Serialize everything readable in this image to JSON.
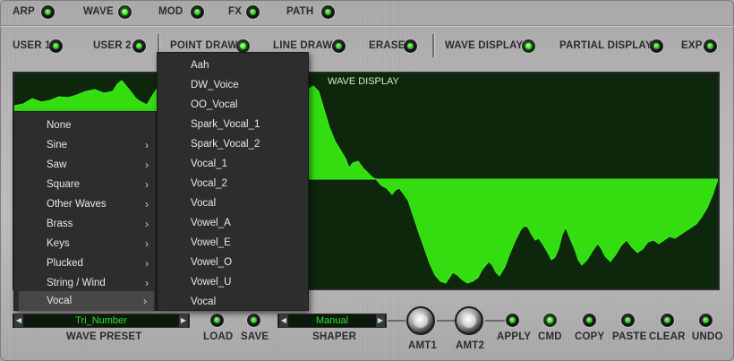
{
  "top_tabs": [
    "ARP",
    "WAVE",
    "MOD",
    "FX",
    "PATH"
  ],
  "toolbar": {
    "user1": "USER 1",
    "user2": "USER 2",
    "point_draw": "POINT DRAW",
    "line_draw": "LINE DRAW",
    "erase": "ERASE",
    "wave_display": "WAVE DISPLAY",
    "partial_display": "PARTIAL DISPLAY",
    "exp": "EXP"
  },
  "display": {
    "title": "WAVE DISPLAY",
    "wave_color": "#33dd10",
    "background": "#0d260c"
  },
  "menu_categories": [
    "None",
    "Sine",
    "Saw",
    "Square",
    "Other Waves",
    "Brass",
    "Keys",
    "Plucked",
    "String / Wind",
    "Vocal"
  ],
  "menu_selected_category": "Vocal",
  "submenu_items": [
    "Aah",
    "DW_Voice",
    "OO_Vocal",
    "Spark_Vocal_1",
    "Spark_Vocal_2",
    "Vocal_1",
    "Vocal_2",
    "Vocal",
    "Vowel_A",
    "Vowel_E",
    "Vowel_O",
    "Vowel_U",
    "Vocal"
  ],
  "bottom": {
    "wave_preset_value": "Tri_Number",
    "wave_preset_label": "WAVE PRESET",
    "load": "LOAD",
    "save": "SAVE",
    "shaper_value": "Manual",
    "shaper_label": "SHAPER",
    "amt1": "AMT1",
    "amt2": "AMT2",
    "apply": "APPLY",
    "cmd": "CMD",
    "copy": "COPY",
    "paste": "PASTE",
    "clear": "CLEAR",
    "undo": "UNDO"
  },
  "colors": {
    "led_green": "#3ef02a",
    "text_green": "#35e02a",
    "panel": "#b5b5b5"
  }
}
